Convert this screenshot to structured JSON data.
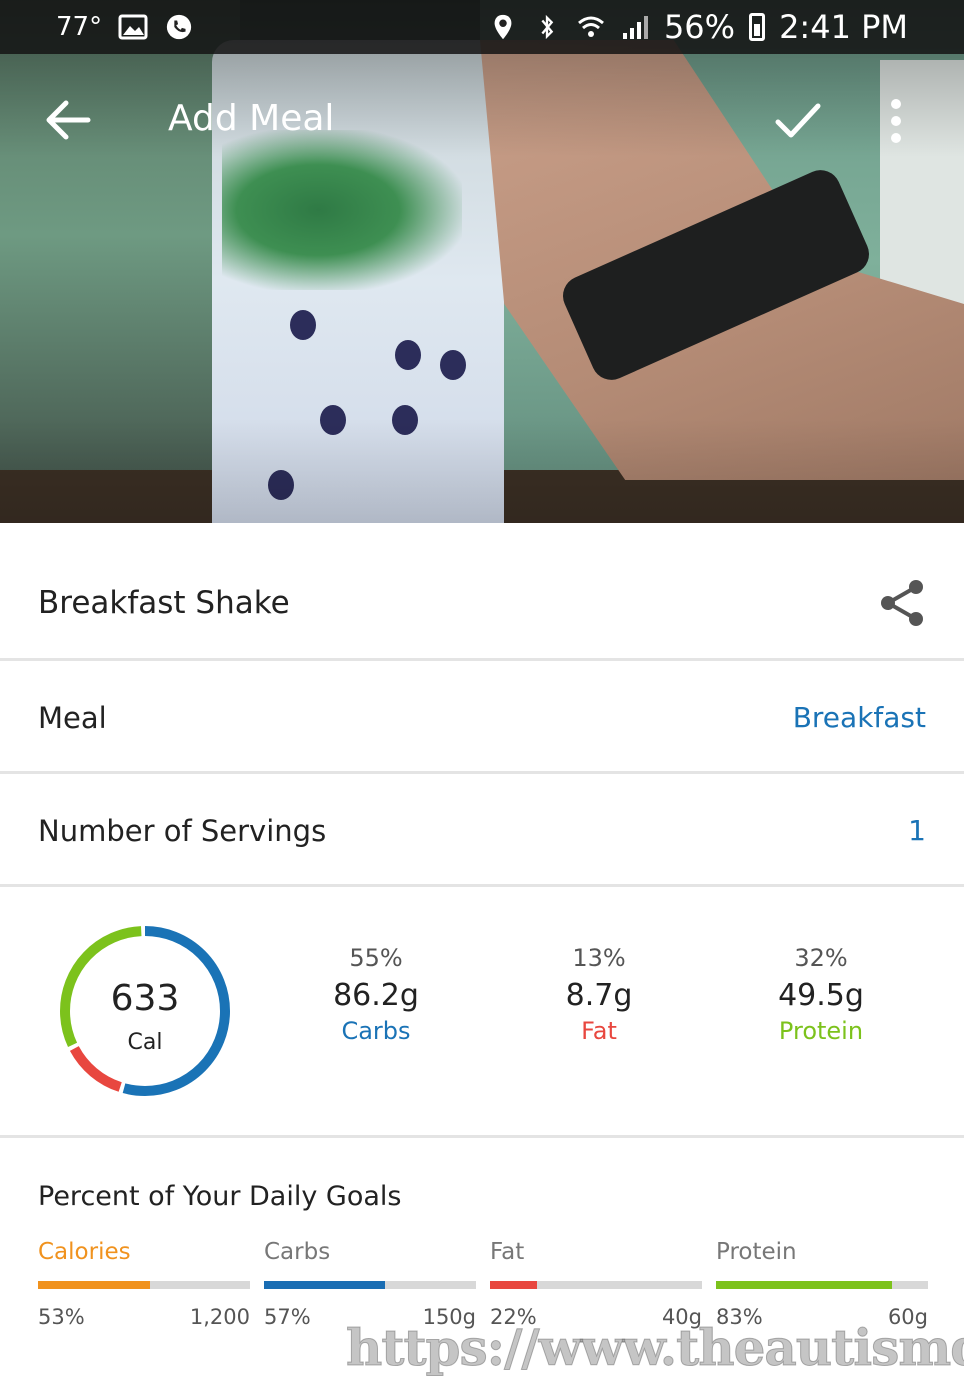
{
  "status_bar": {
    "temperature": "77°",
    "battery_percent": "56%",
    "time": "2:41 PM"
  },
  "app_bar": {
    "title": "Add Meal"
  },
  "meal_name": "Breakfast Shake",
  "meal_row": {
    "label": "Meal",
    "value": "Breakfast"
  },
  "servings_row": {
    "label": "Number of Servings",
    "value": "1"
  },
  "summary": {
    "calories": "633",
    "calories_unit": "Cal",
    "macros": [
      {
        "percent": "55%",
        "grams": "86.2g",
        "name": "Carbs",
        "color": "#1a73b6"
      },
      {
        "percent": "13%",
        "grams": "8.7g",
        "name": "Fat",
        "color": "#e8473f"
      },
      {
        "percent": "32%",
        "grams": "49.5g",
        "name": "Protein",
        "color": "#7cc21c"
      }
    ]
  },
  "daily_goals": {
    "heading": "Percent of Your Daily Goals",
    "items": [
      {
        "name": "Calories",
        "percent": "53%",
        "target": "1,200",
        "fraction": 0.53,
        "color": "#f0921e",
        "name_color": "#f0921e"
      },
      {
        "name": "Carbs",
        "percent": "57%",
        "target": "150g",
        "fraction": 0.57,
        "color": "#1a6db3",
        "name_color": "#777777"
      },
      {
        "name": "Fat",
        "percent": "22%",
        "target": "40g",
        "fraction": 0.22,
        "color": "#e8473f",
        "name_color": "#777777"
      },
      {
        "name": "Protein",
        "percent": "83%",
        "target": "60g",
        "fraction": 0.83,
        "color": "#7cc21c",
        "name_color": "#777777"
      }
    ]
  },
  "watermark": "https://www.theautismdad.c",
  "icons": {
    "back": "arrow-left-icon",
    "confirm": "check-icon",
    "more": "more-vertical-icon",
    "share": "share-icon"
  }
}
